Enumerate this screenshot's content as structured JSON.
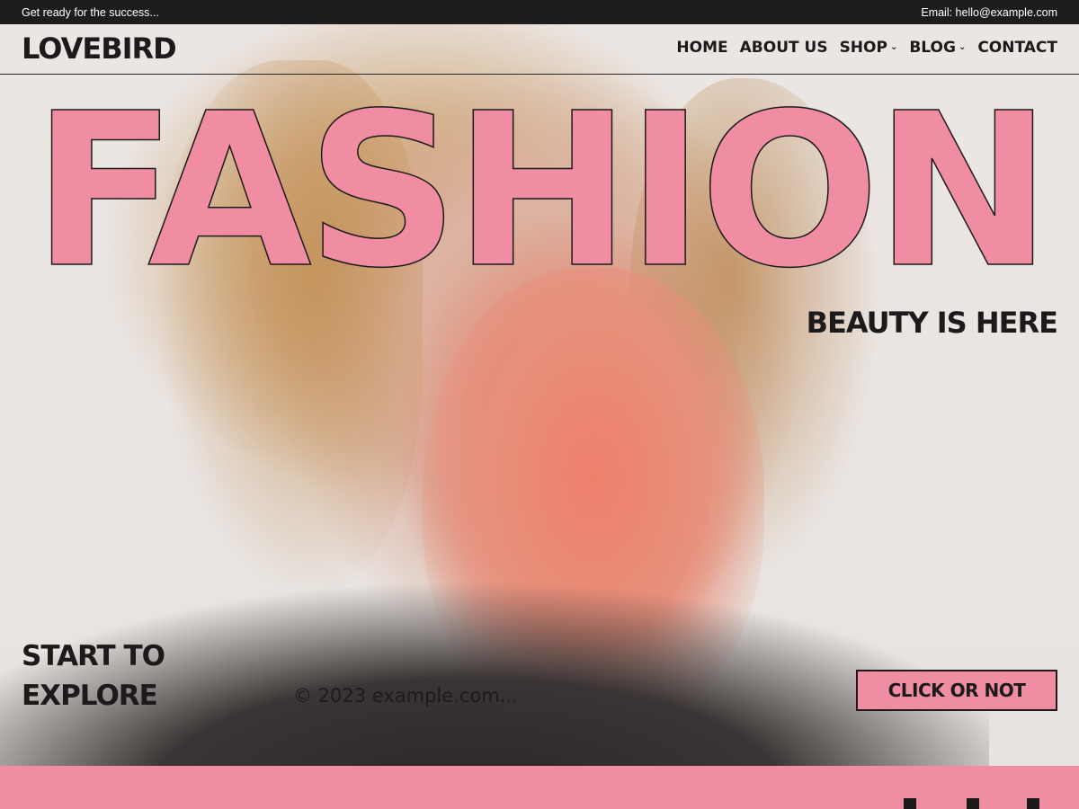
{
  "topbar": {
    "left_text": "Get ready for the success...",
    "right_text": "Email: hello@example.com"
  },
  "header": {
    "logo": "LOVEBIRD",
    "nav": [
      {
        "label": "HOME",
        "has_dropdown": false
      },
      {
        "label": "ABOUT US",
        "has_dropdown": false
      },
      {
        "label": "SHOP",
        "has_dropdown": true
      },
      {
        "label": "BLOG",
        "has_dropdown": true
      },
      {
        "label": "CONTACT",
        "has_dropdown": false
      }
    ],
    "dropdown_icon": "chevron-down-icon"
  },
  "hero": {
    "headline": "FASHION",
    "tagline": "BEAUTY IS HERE",
    "explore_line1": "START TO",
    "explore_line2": "EXPLORE",
    "copyright": "© 2023 example.com...",
    "cta_label": "CLICK OR NOT"
  },
  "colors": {
    "accent_pink": "#f08da3",
    "dark": "#1c1a1a",
    "background": "#ebe6e3",
    "topbar": "#1e1c1d"
  }
}
